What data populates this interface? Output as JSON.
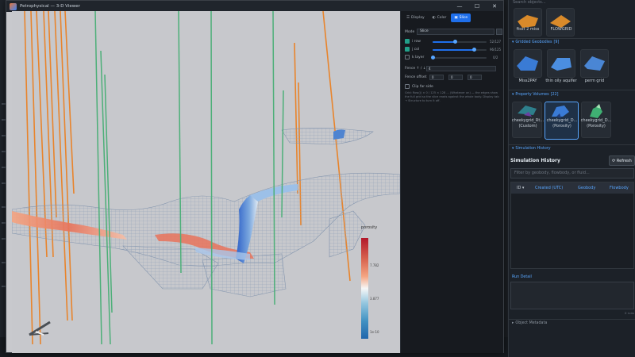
{
  "viewer": {
    "title": "Petrophysical — 3-D Viewer",
    "window_buttons": {
      "minimize": "—",
      "maximize": "☐",
      "close": "✕"
    },
    "legend": {
      "title": "porosity",
      "sub": "",
      "ticks": [
        "7.782",
        "3.877",
        "1e-10"
      ]
    }
  },
  "panel": {
    "tabs": [
      {
        "icon": "☰",
        "label": "Display"
      },
      {
        "icon": "◐",
        "label": "Color"
      },
      {
        "icon": "▣",
        "label": "Slice"
      }
    ],
    "active_tab": 2,
    "mode_label": "Mode",
    "mode_value": "Slice",
    "rows": [
      {
        "label": "i",
        "sub": "row",
        "value": "52/127",
        "level": 0.41,
        "checked": true
      },
      {
        "label": "j",
        "sub": "col",
        "value": "96/125",
        "level": 0.77,
        "checked": true
      },
      {
        "label": "k",
        "sub": "layer",
        "value": "0/2",
        "level": 0.0,
        "checked": false
      }
    ],
    "fence_label": "Fence ↑ / ↓",
    "fence_value": "4",
    "fence_offset_label": "Fence offset",
    "offset_values": [
      "0",
      "0",
      "0"
    ],
    "clip_label": "Clip far side",
    "hint": "Grid: Row(j) × 0 / 125 × 128 ... (Whatever on) — the edges show the full grid so the slice reads against the whole body. Display tab → Structure to turn it off."
  },
  "browser": {
    "search_placeholder": "Search objects...",
    "top_items": [
      {
        "label": "ftsst 2 miss"
      },
      {
        "label": "FLOWGRID"
      }
    ],
    "gridded_header": "Gridded Geobodies",
    "gridded_count": "[9]",
    "gridded_items": [
      {
        "label": "Miss2PAY"
      },
      {
        "label": "thin oily aquifer"
      },
      {
        "label": "perm grid"
      }
    ],
    "property_header": "Property Volumes",
    "property_count": "[22]",
    "property_items": [
      {
        "label": "cheekygrid_Rt...",
        "sub": "(Custom)"
      },
      {
        "label": "cheekygrid_D...",
        "sub": "(Porosity)"
      },
      {
        "label": "cheekygrid_D...",
        "sub": "(Porosity)"
      }
    ],
    "sim_header": "Simulation History",
    "sim_title": "Simulation History",
    "refresh_label": "⟳ Refresh",
    "filter_placeholder": "Filter by geobody, flowbody, or fluid...",
    "table_columns": [
      "ID ▾",
      "Created (UTC)",
      "Geobody",
      "Flowbody"
    ],
    "run_detail_label": "Run Detail",
    "runs_count": "0 runs",
    "object_metadata_label": "Object Metadata"
  },
  "colors": {
    "accent": "#1f6feb",
    "link": "#58a6ff",
    "well_orange": "#e8842c",
    "well_green": "#4caf78",
    "mesh": "#8a9bb3"
  }
}
